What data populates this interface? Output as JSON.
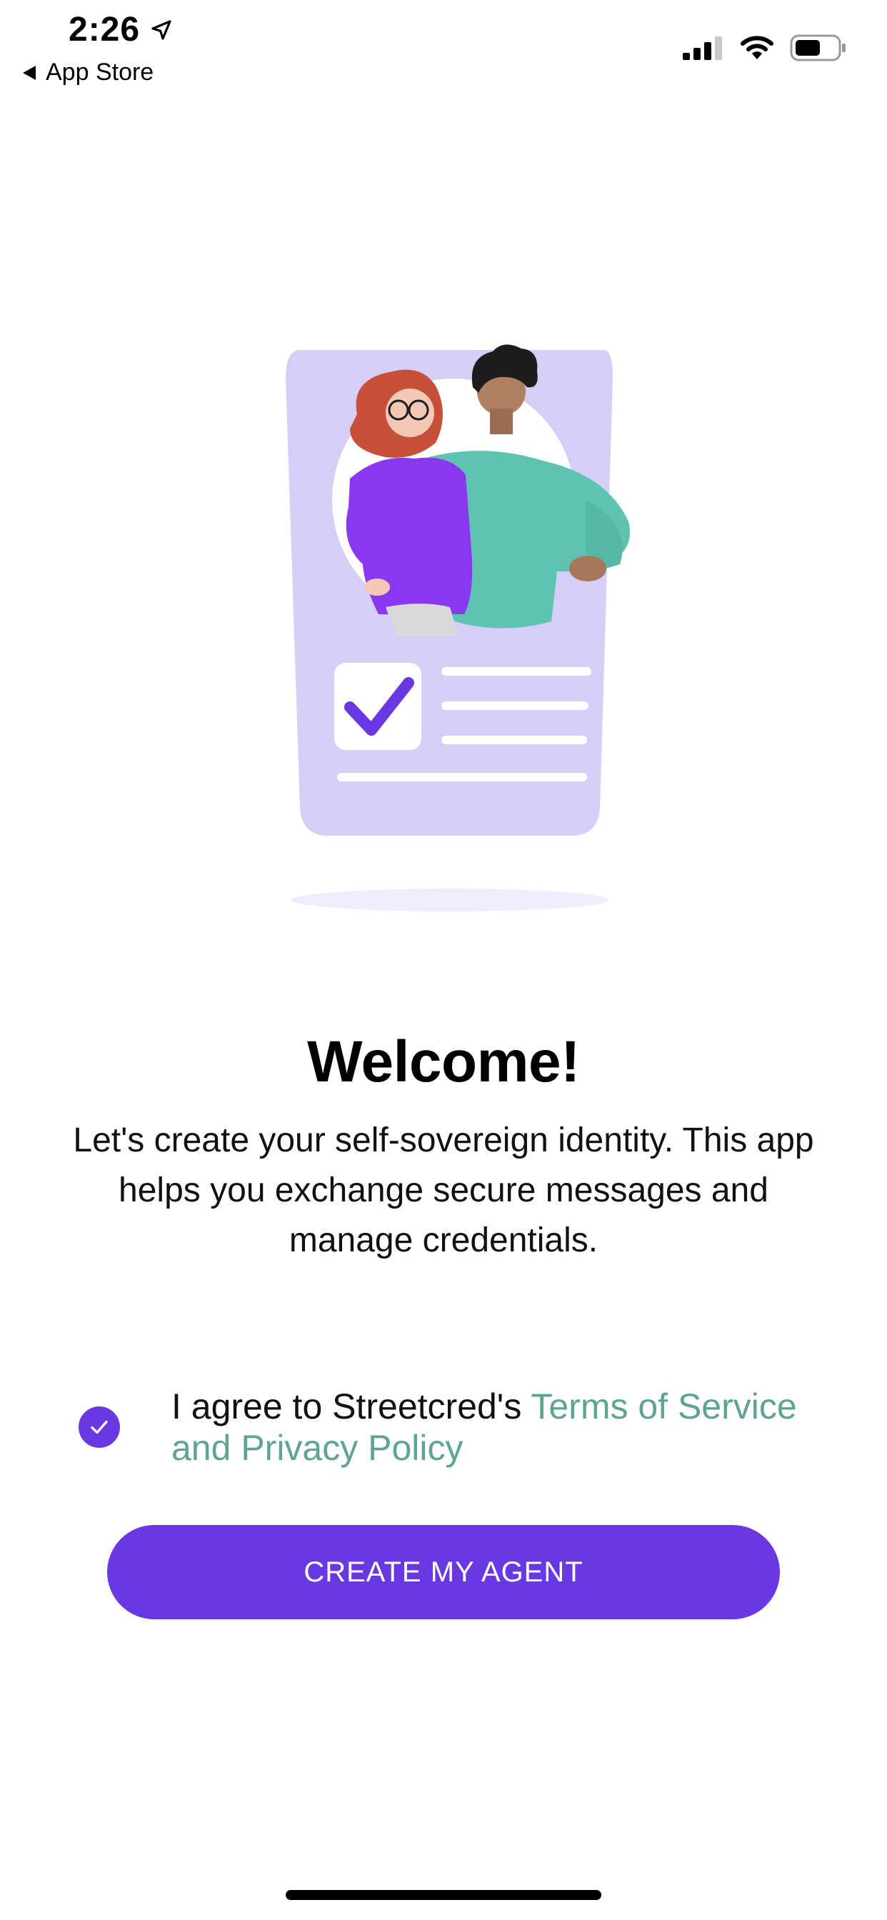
{
  "status_bar": {
    "time": "2:26",
    "back_label": "App Store"
  },
  "welcome": {
    "title": "Welcome!",
    "body": "Let's create your self-sovereign identity. This app helps you exchange secure messages and manage credentials."
  },
  "agreement": {
    "prefix": "I agree to Streetcred's ",
    "link_text": "Terms of Service and Privacy Policy",
    "checked": true
  },
  "primary_button": {
    "label": "CREATE MY AGENT"
  },
  "colors": {
    "accent": "#6a38e3",
    "link": "#5fa394",
    "card": "#d5cef6"
  },
  "icons": {
    "location": "location-arrow-icon",
    "back": "back-triangle-icon",
    "signal": "cellular-signal-icon",
    "wifi": "wifi-icon",
    "battery": "battery-icon",
    "check": "check-icon"
  }
}
